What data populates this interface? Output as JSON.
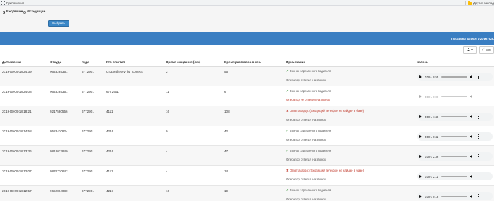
{
  "bookmarks": {
    "apps_label": "Приложения",
    "other_label": "Другие заклад"
  },
  "filter": {
    "incoming_label": "Входящие",
    "outgoing_label": "Исходящие",
    "selected": "incoming",
    "submit_label": "Выбрать"
  },
  "summary": {
    "info": "Показаны записи 1-20 из 628."
  },
  "toolbar": {
    "all_label": "Все"
  },
  "table": {
    "columns": [
      "Дата звонка",
      "Откуда",
      "Куда",
      "Кто ответил",
      "Время ожидания (сек)",
      "Время разговора в сек.",
      "Примечание",
      "запись"
    ],
    "rows": [
      {
        "date": "2019-09-09 18:24:39",
        "from": "9643285351",
        "to": "6772901",
        "answered": "U4336@exsv_bd_context",
        "wait": "2",
        "talk": "55",
        "status": "ok",
        "note": "Звонок зарезанного водителя",
        "note2": "Оператор ответил на звонок",
        "audio": "0:00 / 0:55"
      },
      {
        "date": "2019-09-09 18:24:08",
        "from": "9643285351",
        "to": "6772901",
        "answered": "6772901",
        "wait": "11",
        "talk": "6",
        "status": "ok",
        "note": "Звонок зарезанного водителя",
        "note2": "Оператор не ответил на звонок",
        "audio": "0:00 / 0:00"
      },
      {
        "date": "2019-09-09 18:18:21",
        "from": "9217580556",
        "to": "6772901",
        "answered": "4111",
        "wait": "16",
        "talk": "108",
        "status": "bad",
        "note": "Ответ агардо: (Входящий телефон не найден в базе)",
        "note2": "Оператор ответил на звонок",
        "audio": "0:00 / 1:48"
      },
      {
        "date": "2019-09-09 18:14:58",
        "from": "9523430824",
        "to": "6772901",
        "answered": "4216",
        "wait": "9",
        "talk": "42",
        "status": "ok",
        "note": "Звонок зарезанного водителя",
        "note2": "Оператор ответил на звонок",
        "audio": "0:00 / 0:42"
      },
      {
        "date": "2019-09-09 18:13:36",
        "from": "9818072840",
        "to": "6772901",
        "answered": "4216",
        "wait": "4",
        "talk": "47",
        "status": "ok",
        "note": "Звонок зарезанного водителя",
        "note2": "Оператор ответил на звонок",
        "audio": "0:00 / 2:36"
      },
      {
        "date": "2019-09-09 18:12:07",
        "from": "9870730642",
        "to": "6772901",
        "answered": "4111",
        "wait": "4",
        "talk": "14",
        "status": "bad",
        "note": "Ответ агардо: (Входящий телефон не найден в базе)",
        "note2": "Оператор ответил на звонок",
        "audio": "0:00 / 2:11"
      },
      {
        "date": "2019-09-09 18:12:57",
        "from": "9652864080",
        "to": "6772901",
        "answered": "4217",
        "wait": "16",
        "talk": "19",
        "status": "ok",
        "note": "Звонок зарезанного водителя",
        "note2": "Оператор ответил на звонок",
        "audio": "0:00 / 0:18"
      }
    ]
  }
}
